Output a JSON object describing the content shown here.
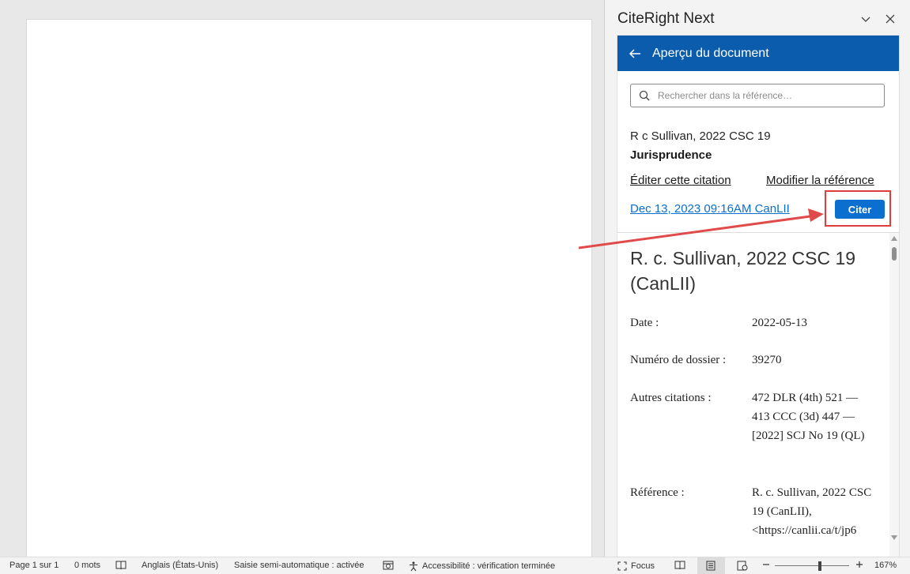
{
  "pane": {
    "title": "CiteRight Next",
    "nav_title": "Aperçu du document",
    "search_placeholder": "Rechercher dans la référence…",
    "case_name": "R c Sullivan, 2022 CSC 19",
    "case_type": "Jurisprudence",
    "edit_link": "Éditer cette citation",
    "modify_link": "Modifier la référence",
    "timestamp": "Dec 13, 2023 09:16AM CanLII",
    "cite_button": "Citer"
  },
  "preview": {
    "title": "R. c. Sullivan, 2022 CSC 19 (CanLII)",
    "fields": [
      {
        "label": "Date :",
        "value": "2022-05-13"
      },
      {
        "label": "Numéro de dossier :",
        "value": "39270"
      },
      {
        "label": "Autres citations :",
        "value": "472 DLR (4th) 521 — 413 CCC (3d) 447 — [2022] SCJ No 19 (QL)"
      },
      {
        "label": "Référence :",
        "value": "R. c. Sullivan, 2022 CSC 19 (CanLII), <https://canlii.ca/t/jp6"
      }
    ]
  },
  "status": {
    "page": "Page 1 sur 1",
    "words": "0 mots",
    "language": "Anglais (États-Unis)",
    "autocomplete": "Saisie semi-automatique : activée",
    "accessibility": "Accessibilité : vérification terminée",
    "focus": "Focus",
    "zoom": "167%"
  },
  "colors": {
    "nav_bar": "#0b5cad",
    "cite_button": "#0b6fd0",
    "highlight": "#e03c3c"
  }
}
